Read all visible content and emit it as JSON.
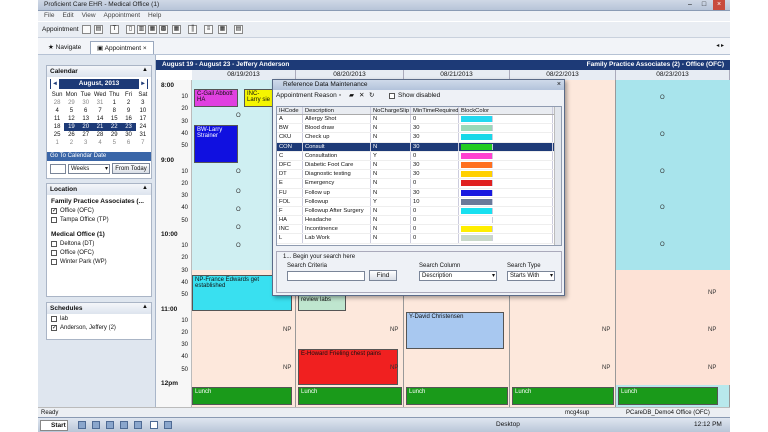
{
  "window": {
    "title": "Proficient Care EHR - Medical Office (1)"
  },
  "menu": [
    "File",
    "Edit",
    "View",
    "Appointment",
    "Help"
  ],
  "toolbar": {
    "label": "Appointment"
  },
  "nav": {
    "navigate_label": "Navigate",
    "appointment_tab": "Appointment"
  },
  "calendar": {
    "title": "Calendar",
    "month_label": "August, 2013",
    "weekdays": [
      "Sun",
      "Mon",
      "Tue",
      "Wed",
      "Thu",
      "Fri",
      "Sat"
    ],
    "weeks": [
      [
        "28",
        "29",
        "30",
        "31",
        "1",
        "2",
        "3"
      ],
      [
        "4",
        "5",
        "6",
        "7",
        "8",
        "9",
        "10"
      ],
      [
        "11",
        "12",
        "13",
        "14",
        "15",
        "16",
        "17"
      ],
      [
        "18",
        "19",
        "20",
        "21",
        "22",
        "23",
        "24"
      ],
      [
        "25",
        "26",
        "27",
        "28",
        "29",
        "30",
        "31"
      ],
      [
        "1",
        "2",
        "3",
        "4",
        "5",
        "6",
        "7"
      ]
    ],
    "goto_label": "Go To Calendar Date",
    "weeks_value": "Weeks",
    "from_today_label": "From Today"
  },
  "location": {
    "title": "Location",
    "group1": "Family Practice Associates (...",
    "group1_items": [
      {
        "label": "Office (OFC)",
        "checked": true
      },
      {
        "label": "Tampa Office (TP)",
        "checked": false
      }
    ],
    "group2": "Medical Office (1)",
    "group2_items": [
      {
        "label": "Deltona (DT)",
        "checked": false
      },
      {
        "label": "Office (OFC)",
        "checked": false
      },
      {
        "label": "Winter Park (WP)",
        "checked": false
      }
    ]
  },
  "schedules": {
    "title": "Schedules",
    "items": [
      {
        "label": "lab",
        "checked": false
      },
      {
        "label": "Anderson, Jeffery (2)",
        "checked": true
      }
    ]
  },
  "schedule": {
    "range_label": "August 19 - August 23 - Jeffery Anderson",
    "practice_label": "Family Practice Associates (2) - Office (OFC)",
    "day_headers": [
      "08/19/2013",
      "08/20/2013",
      "08/21/2013",
      "08/22/2013",
      "08/23/2013"
    ],
    "hours": [
      "8:00",
      "9:00",
      "10:00",
      "11:00",
      "12pm"
    ],
    "minutes": [
      "10",
      "20",
      "30",
      "40",
      "50"
    ],
    "appointments": [
      {
        "text": "C-Gail Abbott HA",
        "color": "#e040e0"
      },
      {
        "text": "INC-Larry sie",
        "color": "#f5f500"
      },
      {
        "text": "BW-Larry Strainer",
        "color": "#1010e0"
      },
      {
        "text": "NP-France Edwards get established",
        "color": "#39e0f0"
      },
      {
        "text": "review labs",
        "color": "#bfe6cf"
      },
      {
        "text": "Y-David Christensen",
        "color": "#a8c8f0"
      },
      {
        "text": "E-Howard Frieling chest pains",
        "color": "#f02020"
      },
      {
        "text": "Lunch",
        "color": "#1a9a1a"
      }
    ],
    "open_marker": "O",
    "np_marker": "NP"
  },
  "dialog": {
    "title": "Reference Data Maintenance",
    "tab_label": "Appointment Reason",
    "show_disabled_label": "Show disabled",
    "columns": [
      "IHCode",
      "Description",
      "NoChargeSlip",
      "MinTimeRequired",
      "BlockColor"
    ],
    "rows": [
      {
        "code": "A",
        "desc": "Allergy Shot",
        "nocharge": "N",
        "min": "0",
        "color": "#22d8f0"
      },
      {
        "code": "BW",
        "desc": "Blood draw",
        "nocharge": "N",
        "min": "30",
        "color": "#9ad8b8"
      },
      {
        "code": "CKU",
        "desc": "Check up",
        "nocharge": "N",
        "min": "30",
        "color": "#18d8e8"
      },
      {
        "code": "CON",
        "desc": "Consult",
        "nocharge": "N",
        "min": "30",
        "color": "#22cc22"
      },
      {
        "code": "C",
        "desc": "Consultation",
        "nocharge": "Y",
        "min": "0",
        "color": "#ff40d0"
      },
      {
        "code": "DFC",
        "desc": "Diabetic Foot Care",
        "nocharge": "N",
        "min": "30",
        "color": "#ff7020"
      },
      {
        "code": "DT",
        "desc": "Diagnostic testing",
        "nocharge": "N",
        "min": "30",
        "color": "#ffd000"
      },
      {
        "code": "E",
        "desc": "Emergency",
        "nocharge": "N",
        "min": "0",
        "color": "#e02020"
      },
      {
        "code": "FU",
        "desc": "Follow up",
        "nocharge": "N",
        "min": "30",
        "color": "#1818e0"
      },
      {
        "code": "FOL",
        "desc": "Followup",
        "nocharge": "Y",
        "min": "10",
        "color": "#6a7a9a"
      },
      {
        "code": "F",
        "desc": "Followup After Surgery",
        "nocharge": "N",
        "min": "0",
        "color": "#18e0f0"
      },
      {
        "code": "HA",
        "desc": "Headache",
        "nocharge": "N",
        "min": "0",
        "color": "#ffffff"
      },
      {
        "code": "INC",
        "desc": "Incontinence",
        "nocharge": "N",
        "min": "0",
        "color": "#ffee00"
      },
      {
        "code": "L",
        "desc": "Lab Work",
        "nocharge": "N",
        "min": "0",
        "color": "#c8d8c8"
      }
    ],
    "search_heading": "1... Begin your search here",
    "search_criteria_label": "Search Criteria",
    "search_criteria_value": "",
    "find_label": "Find",
    "search_column_label": "Search Column",
    "search_column_value": "Description",
    "search_type_label": "Search Type",
    "search_type_value": "Starts With"
  },
  "status": {
    "left": "Ready",
    "user": "mcg4sup",
    "db": "PCareDB_Demo4",
    "office": "Office (OFC)"
  },
  "taskbar": {
    "start_label": "Start",
    "desktop_label": "Desktop",
    "clock": "12:12 PM"
  },
  "colors": {
    "accent": "#1d3a77",
    "selected_row": "#1d3a77"
  }
}
